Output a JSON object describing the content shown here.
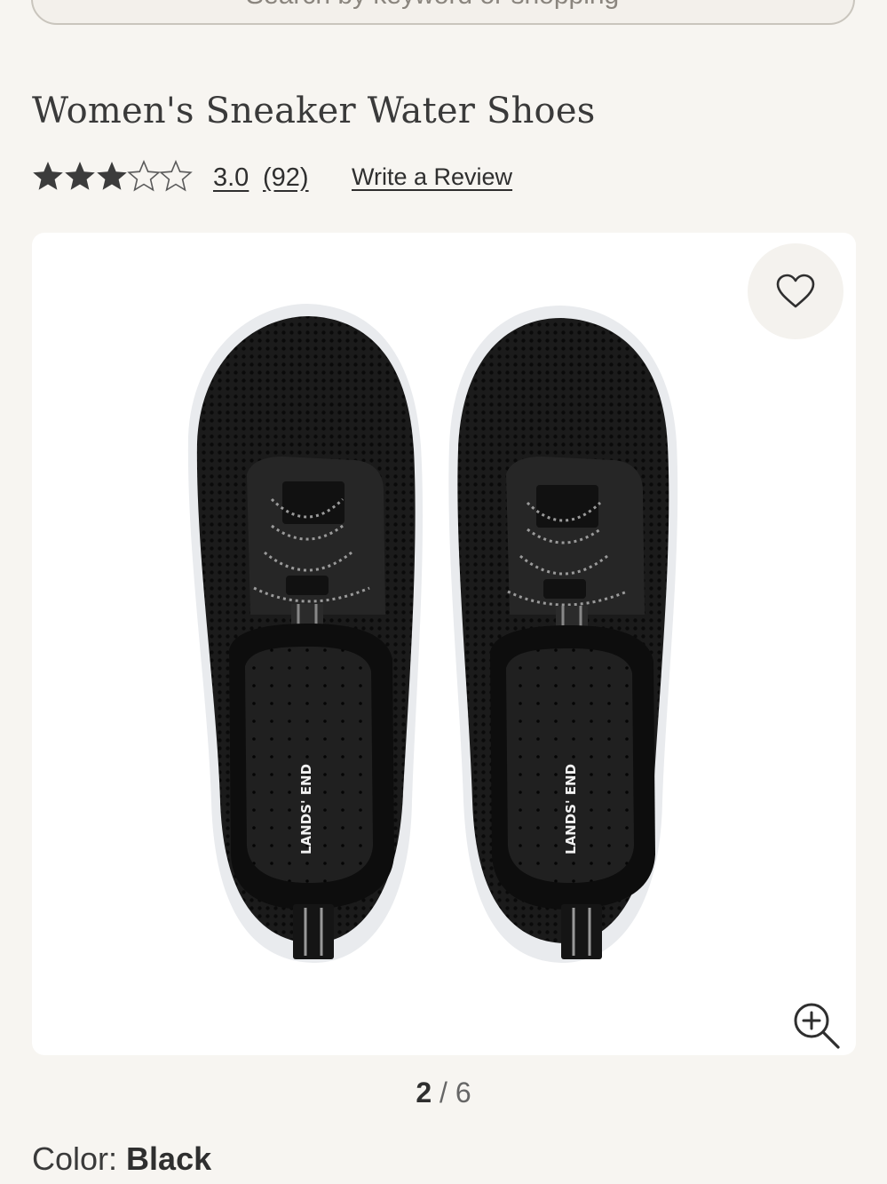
{
  "search": {
    "placeholder": "Search by keyword or shopping"
  },
  "product": {
    "title": "Women's Sneaker Water Shoes",
    "rating_value": "3.0",
    "review_count": "(92)",
    "rating_stars": 3.0,
    "write_review_label": "Write a Review",
    "brand_print": "LANDS' END"
  },
  "gallery": {
    "current": "2",
    "separator": "/",
    "total": "6"
  },
  "color": {
    "label": "Color:",
    "value": "Black"
  },
  "colors": {
    "background": "#f7f5f1",
    "text": "#2f2f2f",
    "star_fill": "#3c3c3c"
  },
  "icons": [
    "search-icon",
    "star-icon",
    "heart-icon",
    "zoom-in-icon"
  ]
}
